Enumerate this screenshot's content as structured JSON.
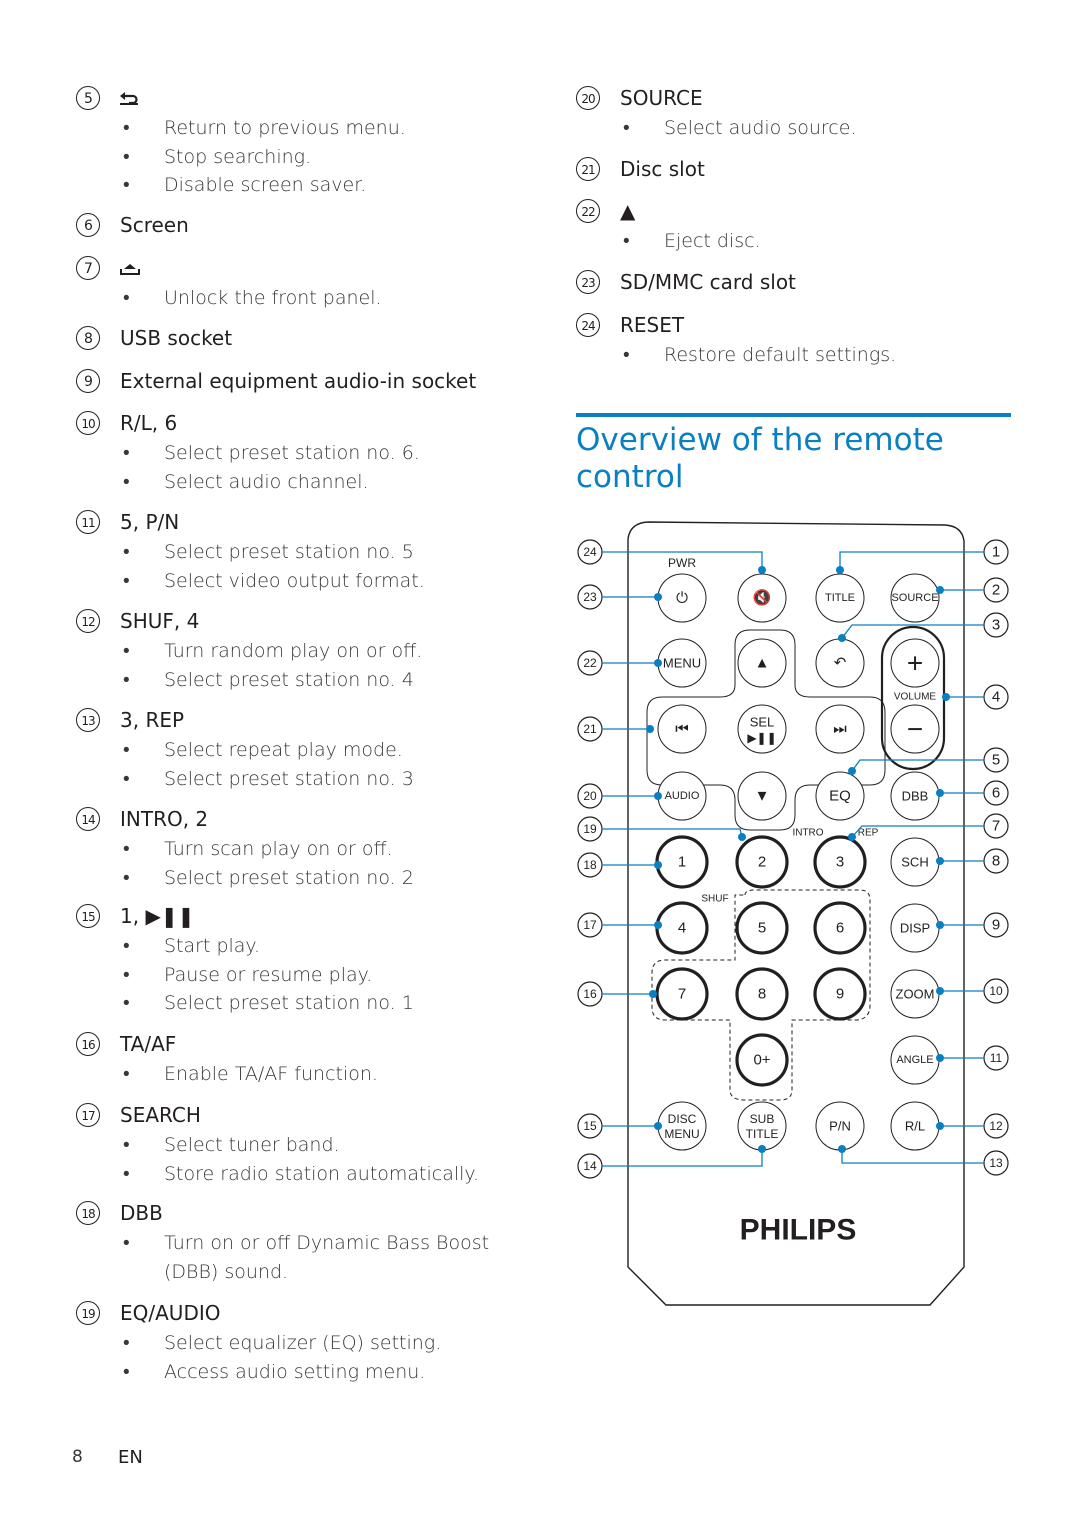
{
  "page": {
    "number": "8",
    "lang": "EN"
  },
  "left_items": [
    {
      "n": "5",
      "title": "",
      "icon": "back-icon",
      "bullets": [
        "Return to previous menu.",
        "Stop searching.",
        "Disable screen saver."
      ]
    },
    {
      "n": "6",
      "title": "Screen",
      "bullets": []
    },
    {
      "n": "7",
      "title": "",
      "icon": "unlock-panel-icon",
      "bullets": [
        "Unlock the front panel."
      ]
    },
    {
      "n": "8",
      "title": "USB socket",
      "bullets": []
    },
    {
      "n": "9",
      "title": "External equipment audio-in socket",
      "bullets": []
    },
    {
      "n": "10",
      "title": "R/L, 6",
      "bullets": [
        "Select preset station no. 6.",
        "Select audio channel."
      ]
    },
    {
      "n": "11",
      "title": "5, P/N",
      "bullets": [
        "Select preset station no. 5",
        "Select video output format."
      ]
    },
    {
      "n": "12",
      "title": "SHUF, 4",
      "bullets": [
        "Turn random play on or off.",
        "Select preset station no. 4"
      ]
    },
    {
      "n": "13",
      "title": "3, REP",
      "bullets": [
        "Select repeat play mode.",
        "Select preset station no. 3"
      ]
    },
    {
      "n": "14",
      "title": "INTRO, 2",
      "bullets": [
        "Turn scan play on or off.",
        "Select preset station no. 2"
      ]
    },
    {
      "n": "15",
      "title": "1, ▶❚❚",
      "bullets": [
        "Start play.",
        "Pause or resume play.",
        "Select preset station no. 1"
      ]
    },
    {
      "n": "16",
      "title": "TA/AF",
      "bullets": [
        "Enable TA/AF function."
      ]
    },
    {
      "n": "17",
      "title": "SEARCH",
      "bullets": [
        "Select tuner band.",
        "Store radio station automatically."
      ]
    },
    {
      "n": "18",
      "title": "DBB",
      "bullets": [
        "Turn on or off Dynamic Bass Boost",
        "(DBB) sound."
      ]
    },
    {
      "n": "19",
      "title": "EQ/AUDIO",
      "bullets": [
        "Select equalizer (EQ) setting.",
        "Access audio setting menu."
      ]
    }
  ],
  "right_items": [
    {
      "n": "20",
      "title": "SOURCE",
      "bullets": [
        "Select audio source."
      ]
    },
    {
      "n": "21",
      "title": "Disc slot",
      "bullets": []
    },
    {
      "n": "22",
      "title": "▲",
      "bullets": [
        "Eject disc."
      ]
    },
    {
      "n": "23",
      "title": "SD/MMC card slot",
      "bullets": []
    },
    {
      "n": "24",
      "title": "RESET",
      "bullets": [
        "Restore default settings."
      ]
    }
  ],
  "section_heading": "Overview of the remote control",
  "remote": {
    "brand": "PHILIPS",
    "accent_color": "#0a7fc2",
    "labels": {
      "pwr": "PWR",
      "volume": "VOLUME",
      "intro": "INTRO",
      "rep": "REP",
      "shuf": "SHUF"
    },
    "buttons": [
      {
        "id": "power",
        "label": "⏻"
      },
      {
        "id": "mute",
        "label": "🔇"
      },
      {
        "id": "title",
        "label": "TITLE"
      },
      {
        "id": "source",
        "label": "SOURCE"
      },
      {
        "id": "menu",
        "label": "MENU"
      },
      {
        "id": "up",
        "label": "▲"
      },
      {
        "id": "back",
        "label": "↶"
      },
      {
        "id": "vol-up",
        "label": "+"
      },
      {
        "id": "prev",
        "label": "⏮"
      },
      {
        "id": "sel",
        "label": "SEL"
      },
      {
        "id": "next",
        "label": "⏭"
      },
      {
        "id": "vol-down",
        "label": "−"
      },
      {
        "id": "audio",
        "label": "AUDIO"
      },
      {
        "id": "down",
        "label": "▼"
      },
      {
        "id": "eq",
        "label": "EQ"
      },
      {
        "id": "dbb",
        "label": "DBB"
      },
      {
        "id": "1",
        "label": "1"
      },
      {
        "id": "2",
        "label": "2"
      },
      {
        "id": "3",
        "label": "3"
      },
      {
        "id": "sch",
        "label": "SCH"
      },
      {
        "id": "4",
        "label": "4"
      },
      {
        "id": "5",
        "label": "5"
      },
      {
        "id": "6",
        "label": "6"
      },
      {
        "id": "disp",
        "label": "DISP"
      },
      {
        "id": "7",
        "label": "7"
      },
      {
        "id": "8",
        "label": "8"
      },
      {
        "id": "9",
        "label": "9"
      },
      {
        "id": "zoom",
        "label": "ZOOM"
      },
      {
        "id": "0",
        "label": "0+"
      },
      {
        "id": "angle",
        "label": "ANGLE"
      },
      {
        "id": "disc-menu",
        "label": "DISC MENU"
      },
      {
        "id": "subtitle",
        "label": "SUB TITLE"
      },
      {
        "id": "pn",
        "label": "P/N"
      },
      {
        "id": "rl",
        "label": "R/L"
      }
    ],
    "callouts_left": [
      "24",
      "23",
      "22",
      "21",
      "20",
      "19",
      "18",
      "17",
      "16",
      "15",
      "14"
    ],
    "callouts_right": [
      "1",
      "2",
      "3",
      "4",
      "5",
      "6",
      "7",
      "8",
      "9",
      "10",
      "11",
      "12",
      "13"
    ]
  }
}
